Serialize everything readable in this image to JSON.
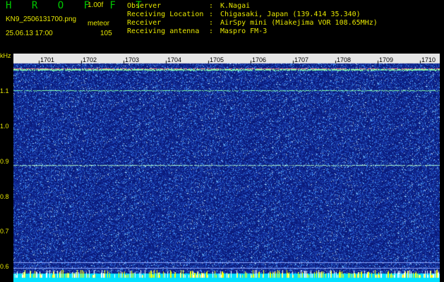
{
  "header": {
    "title": "H R O F F T",
    "version": "1.00f",
    "filename": "KN9_2506131700.png",
    "datetime": "25.06.13 17:00",
    "meteor_label": "meteor",
    "meteor_count": "105"
  },
  "info": {
    "observer": {
      "key": "Observer",
      "sep": ":",
      "value": "K.Nagai"
    },
    "location": {
      "key": "Receiving Location",
      "sep": ":",
      "value": "Chigasaki, Japan (139.414 35.340)"
    },
    "receiver": {
      "key": "Receiver",
      "sep": ":",
      "value": "AirSpy mini (Miakejima VOR 108.65MHz)"
    },
    "antenna": {
      "key": "Receiving antenna",
      "sep": ":",
      "value": "Maspro FM-3"
    }
  },
  "axis": {
    "unit": "kHz",
    "y_ticks": [
      "1.1",
      "1.0",
      "0.9",
      "0.8",
      "0.7",
      "0.6"
    ],
    "x_ticks": [
      "1701",
      "1702",
      "1703",
      "1704",
      "1705",
      "1706",
      "1707",
      "1708",
      "1709",
      "1710"
    ]
  },
  "colors": {
    "background": "#0a1a7a",
    "noise_bright": "#4fa8ff",
    "trace": "#7fffb0",
    "label_yellow": "#e6e600",
    "bottom_band": "#00e0ff"
  }
}
